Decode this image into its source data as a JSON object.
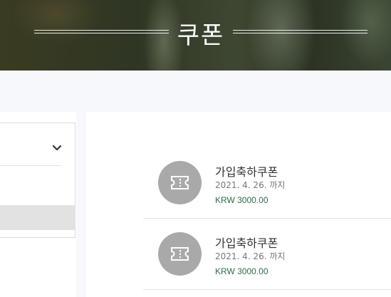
{
  "header": {
    "title": "쿠폰"
  },
  "sidebar": {
    "dropdown": {
      "icon": "chevron-down-icon"
    }
  },
  "coupons": [
    {
      "name": "가입축하쿠폰",
      "expiry": "2021. 4. 26. 까지",
      "amount": "KRW 3000.00",
      "icon": "ticket-icon"
    },
    {
      "name": "가입축하쿠폰",
      "expiry": "2021. 4. 26. 까지",
      "amount": "KRW 3000.00",
      "icon": "ticket-icon"
    }
  ],
  "colors": {
    "amount_text": "#2f6b4a",
    "icon_circle": "#a9a9a9",
    "selected_row": "#e2e2e2",
    "page_background": "#f7f8fb"
  }
}
